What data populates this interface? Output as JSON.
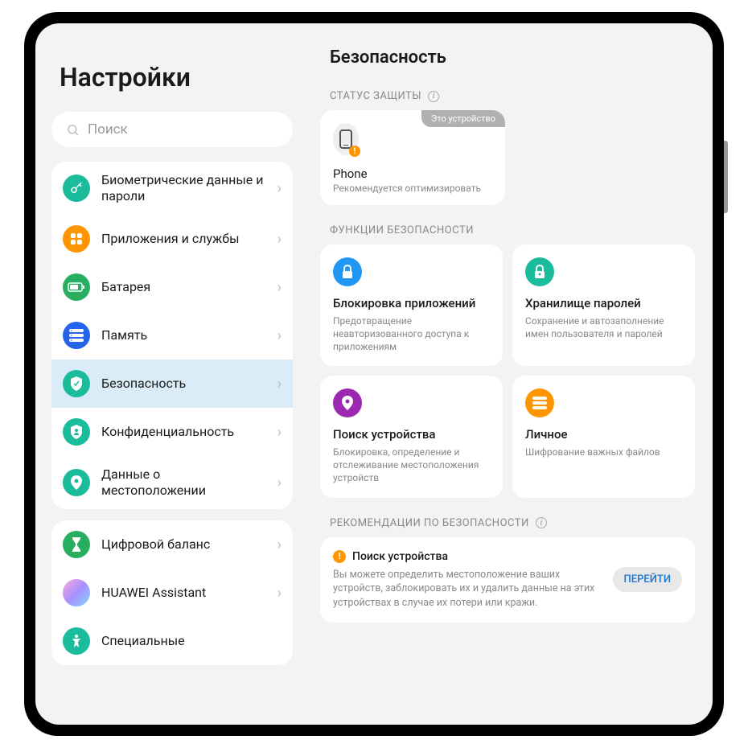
{
  "sidebar": {
    "title": "Настройки",
    "search_placeholder": "Поиск",
    "groups": [
      {
        "items": [
          {
            "label": "Биометрические данные и пароли",
            "icon": "key",
            "color": "#1abc9c"
          },
          {
            "label": "Приложения и службы",
            "icon": "apps",
            "color": "#ff9500"
          },
          {
            "label": "Батарея",
            "icon": "battery",
            "color": "#27ae60"
          },
          {
            "label": "Память",
            "icon": "storage",
            "color": "#2563eb"
          },
          {
            "label": "Безопасность",
            "icon": "shield",
            "color": "#1abc9c",
            "selected": true
          },
          {
            "label": "Конфиденциаль­ность",
            "icon": "privacy",
            "color": "#1abc9c"
          },
          {
            "label": "Данные о местоположении",
            "icon": "location",
            "color": "#1abc9c"
          }
        ]
      },
      {
        "items": [
          {
            "label": "Цифровой баланс",
            "icon": "hourglass",
            "color": "#27ae60"
          },
          {
            "label": "HUAWEI Assistant",
            "icon": "assistant",
            "color": "gradient"
          },
          {
            "label": "Специальные",
            "icon": "accessibility",
            "color": "#1abc9c"
          }
        ]
      }
    ]
  },
  "main": {
    "title": "Безопасность",
    "protection_status": {
      "label": "СТАТУС ЗАЩИТЫ",
      "badge": "Это устройство",
      "device_name": "Phone",
      "device_status": "Рекомендуется оптимизировать"
    },
    "features": {
      "label": "ФУНКЦИИ БЕЗОПАСНОСТИ",
      "cards": [
        {
          "title": "Блокировка приложений",
          "desc": "Предотвращение неавторизованного доступа к приложениям",
          "icon": "lock",
          "color": "#2196f3"
        },
        {
          "title": "Хранилище паролей",
          "desc": "Сохранение и автозаполнение имен пользователя и паролей",
          "icon": "vault",
          "color": "#1abc9c"
        },
        {
          "title": "Поиск устройства",
          "desc": "Блокировка, определение и отслеживание местоположения устройств",
          "icon": "pin",
          "color": "#9c27b0"
        },
        {
          "title": "Личное",
          "desc": "Шифрование важных файлов",
          "icon": "safe",
          "color": "#ff9500"
        }
      ]
    },
    "recommendations": {
      "label": "РЕКОМЕНДАЦИИ ПО БЕЗОПАСНОСТИ",
      "title": "Поиск устройства",
      "desc": "Вы можете определить местоположение ваших устройств, заблокировать их и удалить данные на этих устройствах в случае их потери или кражи.",
      "button": "ПЕРЕЙТИ"
    }
  }
}
